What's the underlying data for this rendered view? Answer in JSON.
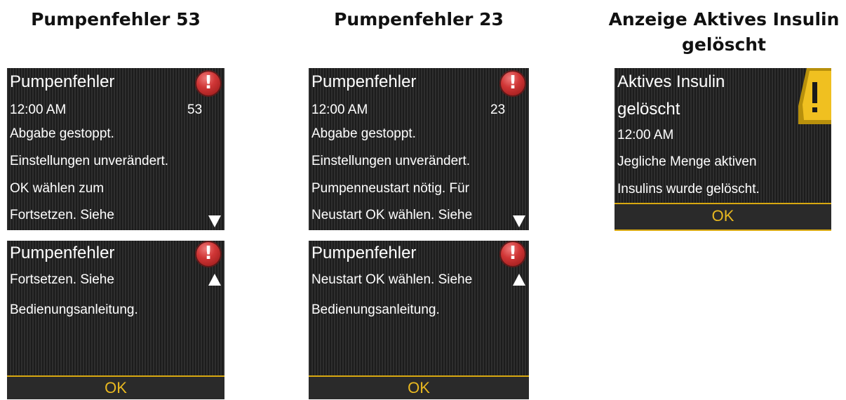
{
  "headings": {
    "col1": "Pumpenfehler 53",
    "col2": "Pumpenfehler 23",
    "col3_line1": "Anzeige Aktives Insulin",
    "col3_line2": "gelöscht"
  },
  "screen_53_a": {
    "title": "Pumpenfehler",
    "time": "12:00 AM",
    "code": "53",
    "lines": [
      "Abgabe gestoppt.",
      "Einstellungen unverändert.",
      "OK wählen zum",
      "Fortsetzen. Siehe"
    ],
    "icon": "alert-error-icon",
    "scroll": "down-arrow-icon"
  },
  "screen_53_b": {
    "title": "Pumpenfehler",
    "lines": [
      "Fortsetzen. Siehe",
      "Bedienungsanleitung."
    ],
    "ok_label": "OK",
    "icon": "alert-error-icon",
    "scroll": "up-arrow-icon"
  },
  "screen_23_a": {
    "title": "Pumpenfehler",
    "time": "12:00 AM",
    "code": "23",
    "lines": [
      "Abgabe gestoppt.",
      "Einstellungen unverändert.",
      "Pumpenneustart nötig. Für",
      "Neustart OK wählen. Siehe"
    ],
    "icon": "alert-error-icon",
    "scroll": "down-arrow-icon"
  },
  "screen_23_b": {
    "title": "Pumpenfehler",
    "lines": [
      "Neustart OK wählen. Siehe",
      "Bedienungsanleitung."
    ],
    "ok_label": "OK",
    "icon": "alert-error-icon",
    "scroll": "up-arrow-icon"
  },
  "screen_insulin": {
    "title_line1": "Aktives Insulin",
    "title_line2": "gelöscht",
    "time": "12:00 AM",
    "lines": [
      "Jegliche Menge aktiven",
      "Insulins wurde gelöscht."
    ],
    "ok_label": "OK",
    "icon": "warning-triangle-icon"
  },
  "colors": {
    "screen_bg": "#262626",
    "accent_yellow": "#e8b820",
    "error_red": "#d03636",
    "warning_yellow": "#f0c020"
  }
}
